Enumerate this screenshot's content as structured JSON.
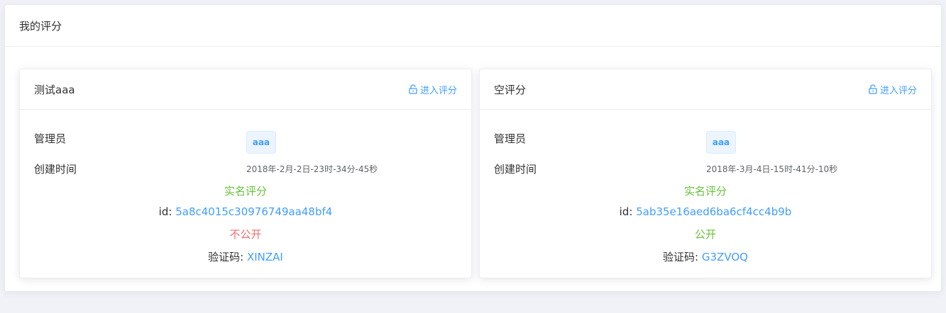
{
  "page": {
    "title": "我的评分"
  },
  "cards": [
    {
      "title": "测试aaa",
      "enter_label": "进入评分",
      "admin_label": "管理员",
      "admin_value": "aaa",
      "created_label": "创建时间",
      "created_value": "2018年-2月-2日-23时-34分-45秒",
      "type_text": "实名评分",
      "id_label": "id:",
      "id_value": "5a8c4015c30976749aa48bf4",
      "visibility": "不公开",
      "code_label": "验证码:",
      "code_value": "XINZAI"
    },
    {
      "title": "空评分",
      "enter_label": "进入评分",
      "admin_label": "管理员",
      "admin_value": "aaa",
      "created_label": "创建时间",
      "created_value": "2018年-3月-4日-15时-41分-10秒",
      "type_text": "实名评分",
      "id_label": "id:",
      "id_value": "5ab35e16aed6ba6cf4cc4b9b",
      "visibility": "公开",
      "code_label": "验证码:",
      "code_value": "G3ZVOQ"
    }
  ],
  "colors": {
    "link": "#409eff",
    "success": "#67c23a",
    "danger": "#f56c6c"
  },
  "icons": {
    "enter": "lock-icon"
  }
}
